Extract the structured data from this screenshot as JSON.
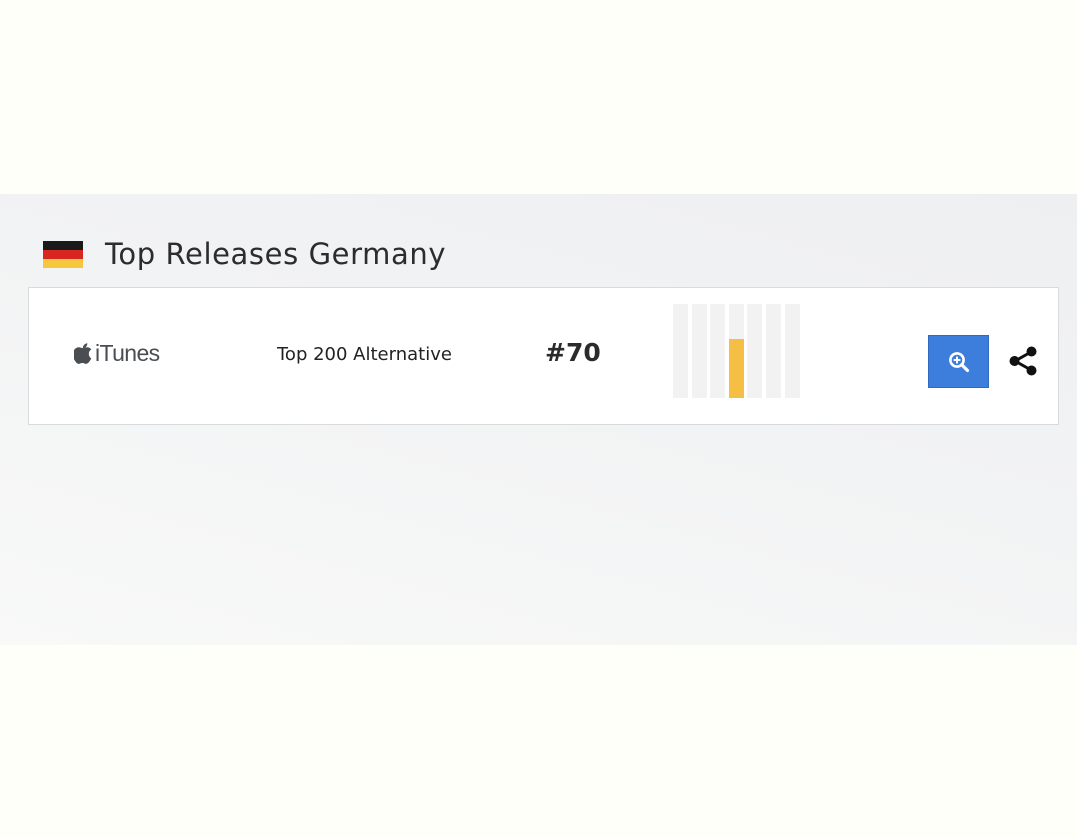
{
  "header": {
    "title": "Top Releases Germany",
    "flag_icon": "germany-flag-icon",
    "flag_colors": [
      "#1a1a1a",
      "#d7261f",
      "#f4c73d"
    ]
  },
  "entry": {
    "store_icon": "apple-icon",
    "store_name": "iTunes",
    "chart_name": "Top 200 Alternative",
    "rank": "#70",
    "history": {
      "type": "bar",
      "highlight_color": "#f5be45",
      "empty_color": "#f2f2f2",
      "values": [
        0,
        0,
        0,
        0.63,
        0,
        0,
        0
      ]
    },
    "zoom_button_icon": "zoom-in-icon",
    "share_icon": "share-icon",
    "accent_color": "#3d7ddb"
  }
}
